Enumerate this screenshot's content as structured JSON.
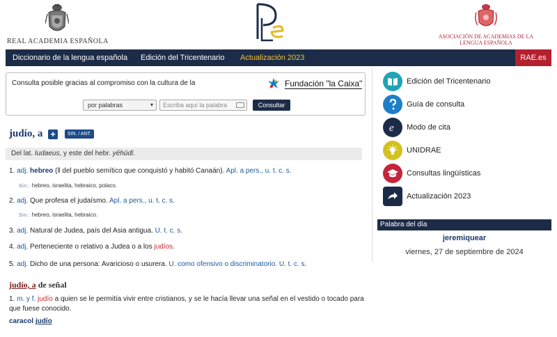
{
  "header": {
    "rae_name": "REAL ACADEMIA ESPAÑOLA",
    "asale_name_line1": "ASOCIACIÓN DE ACADEMIAS DE LA",
    "asale_name_line2": "LENGUA ESPAÑOLA"
  },
  "nav": {
    "items": [
      "Diccionario de la lengua española",
      "Edición del Tricentenario",
      "Actualización 2023"
    ],
    "rae_link": "RAE.es"
  },
  "search": {
    "caption": "Consulta posible gracias al compromiso con la cultura de la",
    "sponsor": "Fundación \"la Caixa\"",
    "mode": "por palabras",
    "placeholder": "Escriba aquí la palabra",
    "button": "Consultar"
  },
  "entry": {
    "lemma": "judío, a",
    "plus": "+",
    "sinant": "SIN. / ANT.",
    "etym_pre": "Del lat. ",
    "etym_word1": "Iudaeus",
    "etym_mid": ", y este del hebr. ",
    "etym_word2": "yĕhūdī",
    "etym_end": ".",
    "s1_num": "1.",
    "s1_abbr": "adj.",
    "s1_word": "hebreo",
    "s1_text": " (‖ del pueblo semítico que conquistó y habitó Canaán).",
    "s1_usage": "Apl. a pers., u. t. c. s.",
    "syn1_label": "Sin.:",
    "syn1_text": "hebreo, israelita, hebraico, polaco.",
    "s2_num": "2.",
    "s2_abbr": "adj.",
    "s2_text": "Que profesa el judaísmo.",
    "s2_usage": "Apl. a pers., u. t. c. s.",
    "syn2_label": "Sin.:",
    "syn2_text": "hebreo, israelita, hebraico.",
    "s3_num": "3.",
    "s3_abbr": "adj.",
    "s3_text": "Natural de Judea, país del Asia antigua.",
    "s3_usage": "U. t. c. s.",
    "s4_num": "4.",
    "s4_abbr": "adj.",
    "s4_text": "Perteneciente o relativo a Judea o a los ",
    "s4_red": "judíos",
    "s4_end": ".",
    "s5_num": "5.",
    "s5_abbr": "adj.",
    "s5_text": "Dicho de una persona: Avaricioso o usurera.",
    "s5_usage": "U. como ofensivo o discriminatorio. U. t. c. s.",
    "sub_lemma_ul": "judío, a",
    "sub_lemma_rest": " de señal",
    "sub_num": "1.",
    "sub_abbr": "m. y f.",
    "sub_red": "judío",
    "sub_text": " a quien se le permitía vivir entre cristianos, y se le hacía llevar una señal en el vestido o tocado para que fuese conocido.",
    "caracol_pre": "caracol ",
    "caracol_word": "judío"
  },
  "sidebar": {
    "items": [
      {
        "label": "Edición del Tricentenario",
        "icon": "book-icon",
        "color": "#1fa3b5"
      },
      {
        "label": "Guía de consulta",
        "icon": "question-icon",
        "color": "#1e7fc9"
      },
      {
        "label": "Modo de cita",
        "icon": "cite-icon",
        "color": "#1c2c48"
      },
      {
        "label": "UNIDRAE",
        "icon": "bulb-icon",
        "color": "#d3c11f"
      },
      {
        "label": "Consultas lingüísticas",
        "icon": "graduation-icon",
        "color": "#c4253b"
      },
      {
        "label": "Actualización 2023",
        "icon": "arrow-icon",
        "color": "#1c2c48"
      }
    ]
  },
  "palabra_del_dia": {
    "heading": "Palabra del día",
    "word": "jeremiquear",
    "date": "viernes, 27 de septiembre de 2024"
  },
  "colors": {
    "nav_bg": "#1c2c48",
    "nav_active": "#f3c234",
    "rae_red": "#b5202e",
    "link_blue": "#1a5a9e"
  }
}
